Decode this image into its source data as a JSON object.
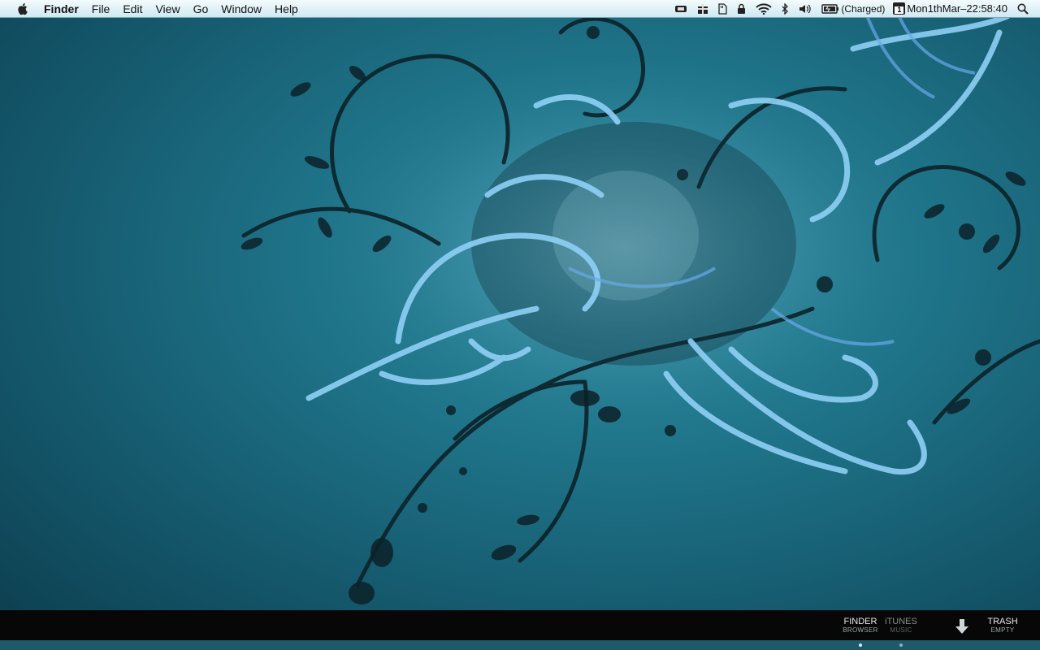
{
  "menubar": {
    "app_name": "Finder",
    "menus": [
      "File",
      "Edit",
      "View",
      "Go",
      "Window",
      "Help"
    ],
    "battery_status": "(Charged)",
    "calendar_day": "1",
    "clock": "Mon1thMar–22:58:40",
    "icons": [
      "apple-icon",
      "box-icon",
      "gift-icon",
      "sd-card-icon",
      "lock-icon",
      "wifi-icon",
      "bluetooth-icon",
      "volume-icon",
      "battery-icon",
      "calendar-icon",
      "spotlight-icon"
    ]
  },
  "dock": {
    "items": [
      {
        "title": "FINDER",
        "sub": "BROWSER"
      },
      {
        "title": "iTUNES",
        "sub": "MUSIC"
      },
      {
        "title": "TRASH",
        "sub": "EMPTY"
      }
    ],
    "downloads_icon": "down-arrow-icon"
  },
  "colors": {
    "wallpaper_base": "#1f7489",
    "menubar": "#e4f4f8",
    "dock": "#070707",
    "swirl_light": "#8fd0f5"
  }
}
